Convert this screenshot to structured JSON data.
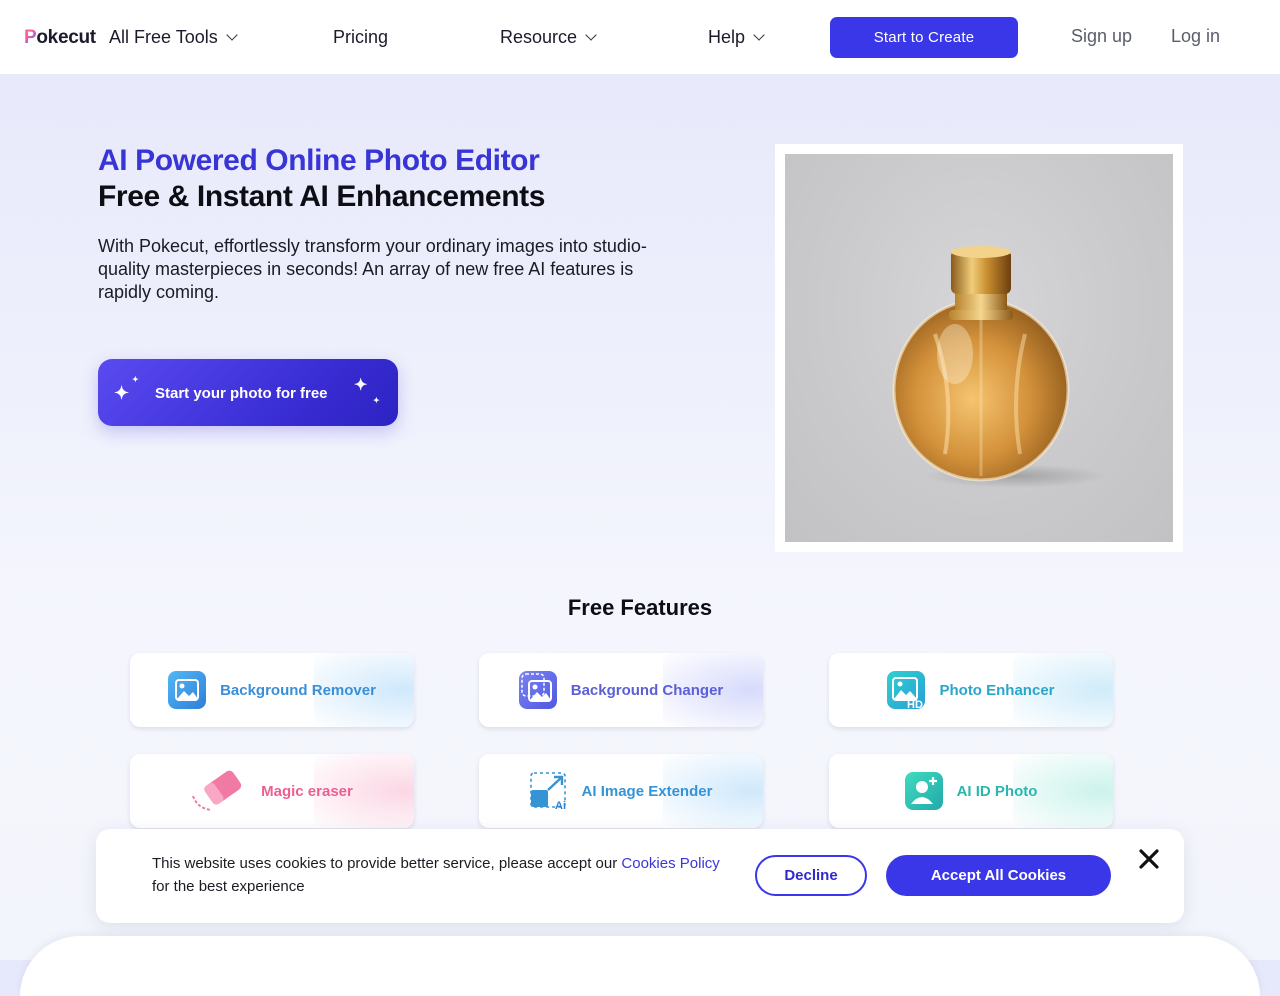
{
  "nav": {
    "logo_mark": "P",
    "logo_rest": "okecut",
    "all_tools": "All Free Tools",
    "pricing": "Pricing",
    "resource": "Resource",
    "help": "Help",
    "start_create": "Start to Create",
    "sign_up": "Sign up",
    "log_in": "Log in"
  },
  "hero": {
    "title_line1": "AI Powered Online Photo Editor",
    "title_line2": "Free & Instant AI Enhancements",
    "description": "With Pokecut, effortlessly transform your ordinary images into studio-quality masterpieces in seconds! An array of new free AI features is rapidly coming.",
    "cta": "Start your photo for free"
  },
  "features": {
    "title": "Free Features",
    "items": [
      {
        "label": "Background Remover",
        "icon": "background-remover-icon",
        "color": "#3a8fd8"
      },
      {
        "label": "Background Changer",
        "icon": "background-changer-icon",
        "color": "#5b5fd8"
      },
      {
        "label": "Photo Enhancer",
        "icon": "photo-enhancer-icon",
        "color": "#2aa6c9"
      },
      {
        "label": "Magic eraser",
        "icon": "magic-eraser-icon",
        "color": "#ec5f92"
      },
      {
        "label": "AI Image Extender",
        "icon": "image-extender-icon",
        "color": "#3594d6"
      },
      {
        "label": "AI ID Photo",
        "icon": "id-photo-icon",
        "color": "#2bb6b0"
      }
    ]
  },
  "cookie": {
    "text_before": "This website uses cookies to provide better service, please accept our ",
    "link": "Cookies Policy",
    "text_after": " for the best experience",
    "decline": "Decline",
    "accept": "Accept All Cookies"
  },
  "colors": {
    "primary": "#3a37e8",
    "accent_title": "#3834d6"
  }
}
